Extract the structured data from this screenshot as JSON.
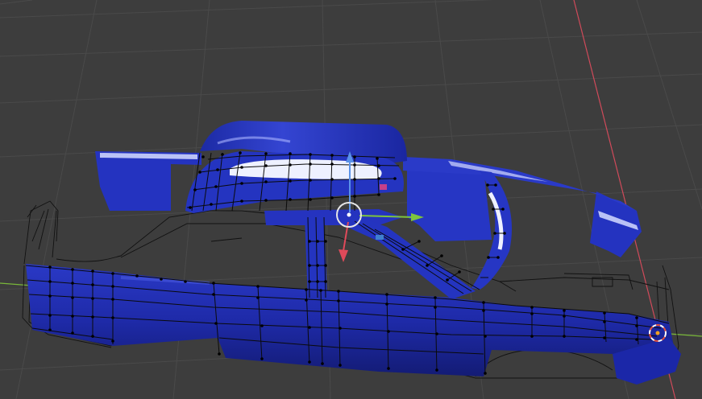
{
  "viewport": {
    "mode": "3d-viewport-edit-mode",
    "background_color": "#3d3d3d",
    "grid_color": "#4a4a4a",
    "x_axis_color": "#d04a5a",
    "y_axis_color": "#7ab93a"
  },
  "object": {
    "kind": "car-body-mesh",
    "material_color": "#1f2fb8",
    "highlight_color": "#e8ecff",
    "wireframe_color": "#111111",
    "vertex_color": "#000000"
  },
  "gizmo": {
    "type": "translate",
    "x_color": "#e04a5a",
    "y_color": "#7ec43c",
    "z_color": "#5a92e8",
    "plane_colors": [
      "#c6408a",
      "#3f7fcf"
    ]
  },
  "cursor_3d": {
    "ring_colors": [
      "#e2503e",
      "#ffffff"
    ],
    "center_color": "#f0a020"
  }
}
